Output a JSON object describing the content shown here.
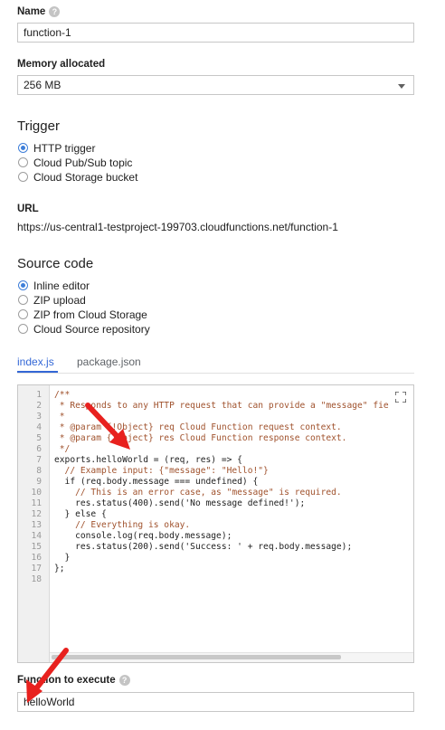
{
  "name": {
    "label": "Name",
    "value": "function-1"
  },
  "memory": {
    "label": "Memory allocated",
    "value": "256 MB"
  },
  "trigger": {
    "title": "Trigger",
    "options": [
      {
        "label": "HTTP trigger",
        "selected": true
      },
      {
        "label": "Cloud Pub/Sub topic",
        "selected": false
      },
      {
        "label": "Cloud Storage bucket",
        "selected": false
      }
    ]
  },
  "url": {
    "label": "URL",
    "value": "https://us-central1-testproject-199703.cloudfunctions.net/function-1"
  },
  "source": {
    "title": "Source code",
    "options": [
      {
        "label": "Inline editor",
        "selected": true
      },
      {
        "label": "ZIP upload",
        "selected": false
      },
      {
        "label": "ZIP from Cloud Storage",
        "selected": false
      },
      {
        "label": "Cloud Source repository",
        "selected": false
      }
    ]
  },
  "tabs": [
    {
      "label": "index.js",
      "active": true
    },
    {
      "label": "package.json",
      "active": false
    }
  ],
  "editor": {
    "line_numbers": [
      "1",
      "2",
      "3",
      "4",
      "5",
      "6",
      "7",
      "8",
      "9",
      "10",
      "11",
      "12",
      "13",
      "14",
      "15",
      "16",
      "17",
      "18"
    ],
    "lines": [
      "/**",
      " * Responds to any HTTP request that can provide a \"message\" fie",
      " *",
      " * @param {!Object} req Cloud Function request context.",
      " * @param {!Object} res Cloud Function response context.",
      " */",
      "exports.helloWorld = (req, res) => {",
      "  // Example input: {\"message\": \"Hello!\"}",
      "  if (req.body.message === undefined) {",
      "    // This is an error case, as \"message\" is required.",
      "    res.status(400).send('No message defined!');",
      "  } else {",
      "    // Everything is okay.",
      "    console.log(req.body.message);",
      "    res.status(200).send('Success: ' + req.body.message);",
      "  }",
      "};",
      ""
    ],
    "fullscreen_icon": "fullscreen-icon"
  },
  "function_to_execute": {
    "label": "Function to execute",
    "value": "helloWorld"
  },
  "colors": {
    "accent": "#3367d6",
    "radio": "#3f7fd9",
    "arrow": "#e8211e"
  }
}
